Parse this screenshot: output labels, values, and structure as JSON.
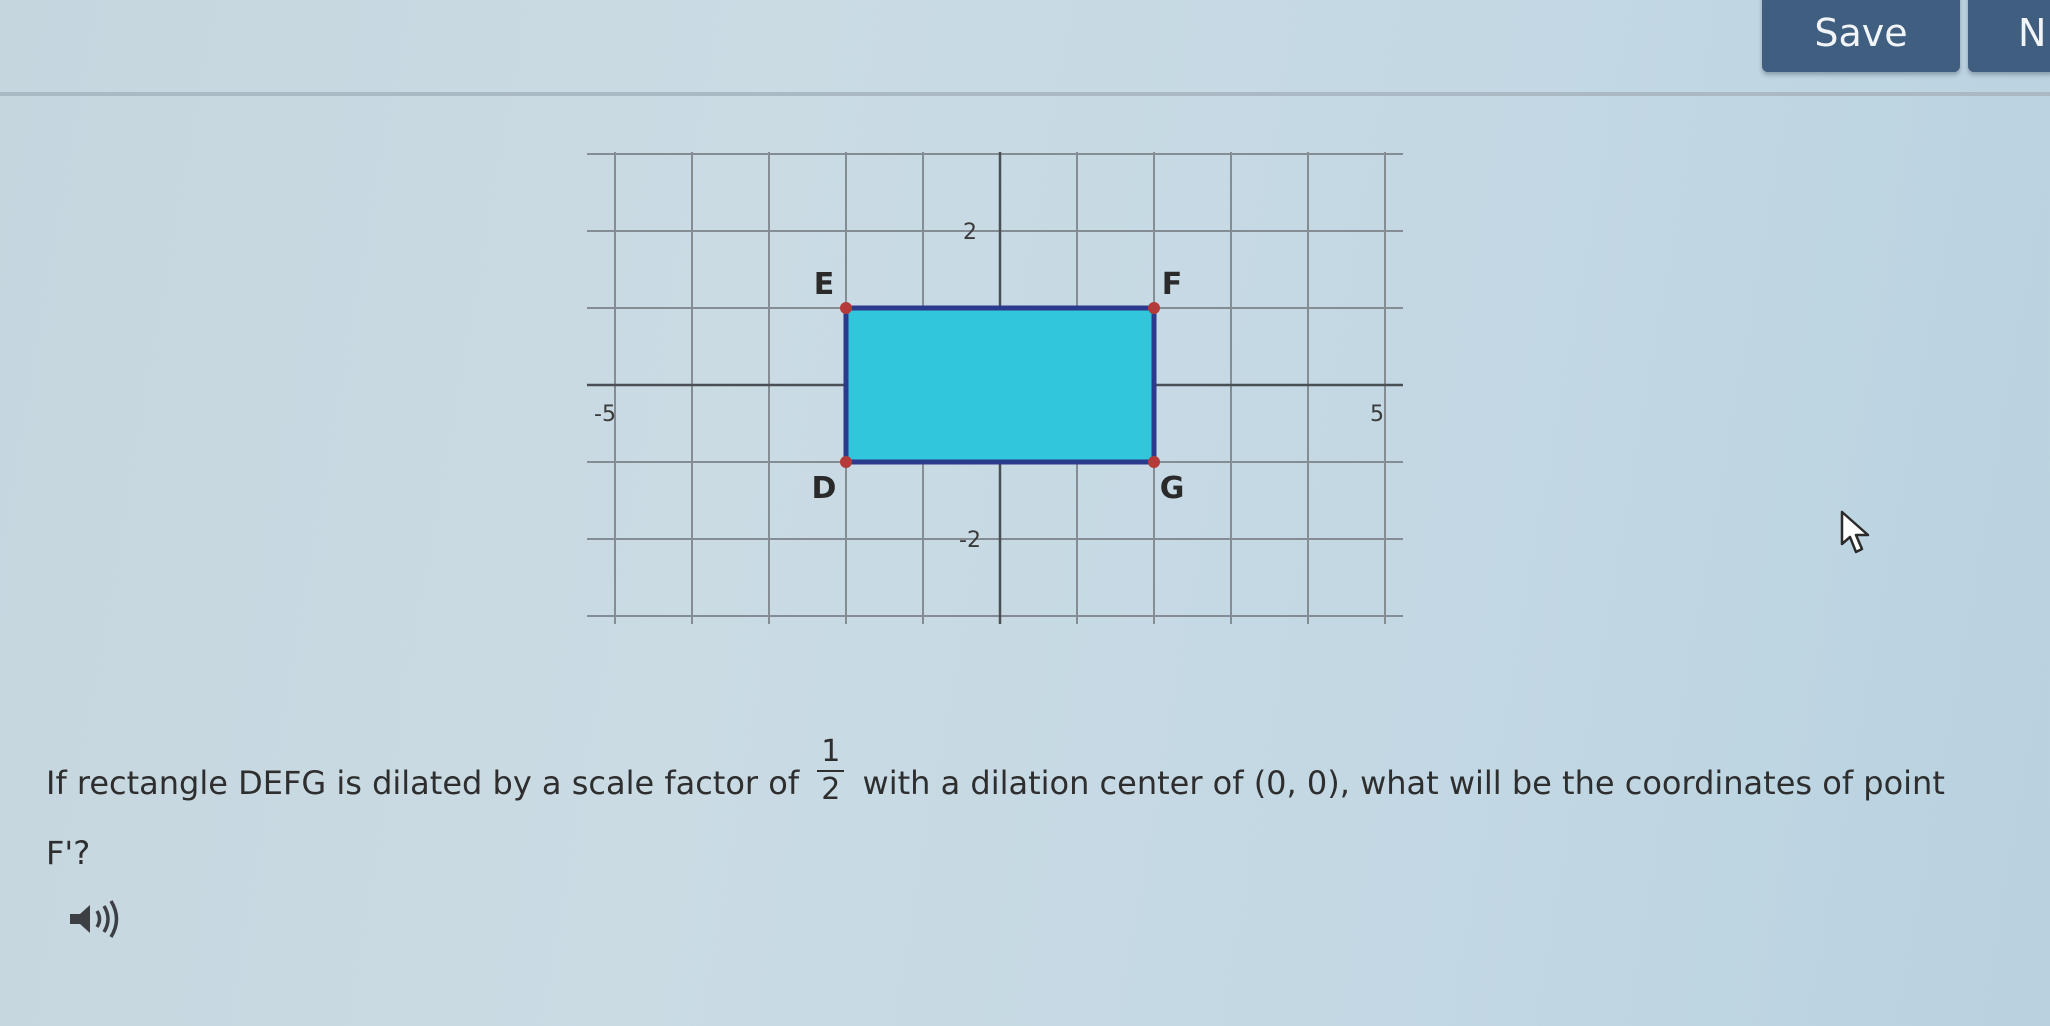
{
  "toolbar": {
    "save_label": "Save",
    "next_label": "N"
  },
  "chart_data": {
    "type": "coordinate-grid",
    "xlim": [
      -5,
      5
    ],
    "ylim": [
      -3,
      3
    ],
    "grid": true,
    "x_tick_labels": [
      {
        "value": -5,
        "label": "-5"
      },
      {
        "value": 5,
        "label": "5"
      }
    ],
    "y_tick_labels": [
      {
        "value": 2,
        "label": "2"
      },
      {
        "value": -2,
        "label": "-2"
      }
    ],
    "shape": {
      "name": "DEFG",
      "fill": "#32c6dd",
      "stroke": "#2b3a8c",
      "vertices": [
        {
          "label": "D",
          "x": -2,
          "y": -1
        },
        {
          "label": "E",
          "x": -2,
          "y": 1
        },
        {
          "label": "F",
          "x": 2,
          "y": 1
        },
        {
          "label": "G",
          "x": 2,
          "y": -1
        }
      ]
    },
    "vertex_color": "#b53a3a"
  },
  "question": {
    "before_fraction": "If rectangle DEFG is dilated by a scale factor of",
    "fraction_numerator": "1",
    "fraction_denominator": "2",
    "after_fraction": "with a dilation center of (0, 0), what will be the coordinates of point",
    "line2": "F'?"
  },
  "icons": {
    "audio": "speaker-icon",
    "cursor": "mouse-pointer-icon"
  }
}
